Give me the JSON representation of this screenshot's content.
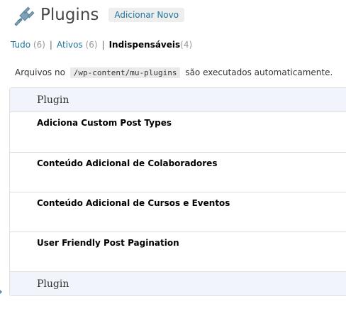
{
  "header": {
    "icon": "plug-icon",
    "title": "Plugins",
    "add_new_label": "Adicionar Novo"
  },
  "filters": {
    "all_label": "Tudo",
    "all_count": "(6)",
    "active_label": "Ativos",
    "active_count": "(6)",
    "mu_label": "Indispensáveis",
    "mu_count": "(4)",
    "separator": "|"
  },
  "notice": {
    "prefix": "Arquivos no",
    "path": "/wp-content/mu-plugins",
    "suffix": "são executados automaticamente."
  },
  "table": {
    "header_label": "Plugin",
    "footer_label": "Plugin",
    "rows": [
      {
        "name": "Adiciona Custom Post Types"
      },
      {
        "name": "Conteúdo Adicional de Colaboradores"
      },
      {
        "name": "Conteúdo Adicional de Cursos e Eventos"
      },
      {
        "name": "User Friendly Post Pagination"
      }
    ]
  },
  "colors": {
    "link": "#21759b",
    "header_bg": "#f1f5fb",
    "border": "#dfdfdf"
  }
}
